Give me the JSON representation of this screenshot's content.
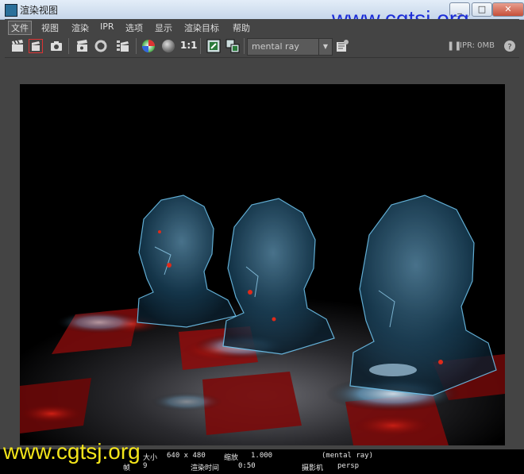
{
  "window": {
    "title": "渲染视图",
    "controls": [
      "_",
      "□",
      "✕"
    ]
  },
  "watermark": {
    "text_top": "www.cgtsj.org",
    "text_bottom": "www.cgtsj.org"
  },
  "menubar": {
    "items": [
      "文件",
      "视图",
      "渲染",
      "IPR",
      "选项",
      "显示",
      "渲染目标",
      "帮助"
    ]
  },
  "toolbar": {
    "ratio_label": "1:1",
    "renderer": "mental ray",
    "ipr_status": "IPR: 0MB",
    "icons": [
      "clapboard-icon",
      "redo-render-icon",
      "snapshot-icon",
      "ipr-render-icon",
      "refresh-icon",
      "region-render-icon",
      "rgb-channel-icon",
      "alpha-channel-icon",
      "keep-image-icon",
      "remove-image-icon",
      "render-settings-icon",
      "pause-icon"
    ]
  },
  "render_image": {
    "description_icon": "render-output-image"
  },
  "status": {
    "size_label": "大小",
    "size_value": "640 x 480",
    "zoom_label": "缩放",
    "zoom_value": "1.000",
    "renderer_value": "(mental ray)",
    "frame_label": "帧",
    "frame_value": "9",
    "render_time_label": "渲染时间",
    "render_time_value": "0:50",
    "camera_label": "摄影机",
    "camera_value": "persp"
  }
}
